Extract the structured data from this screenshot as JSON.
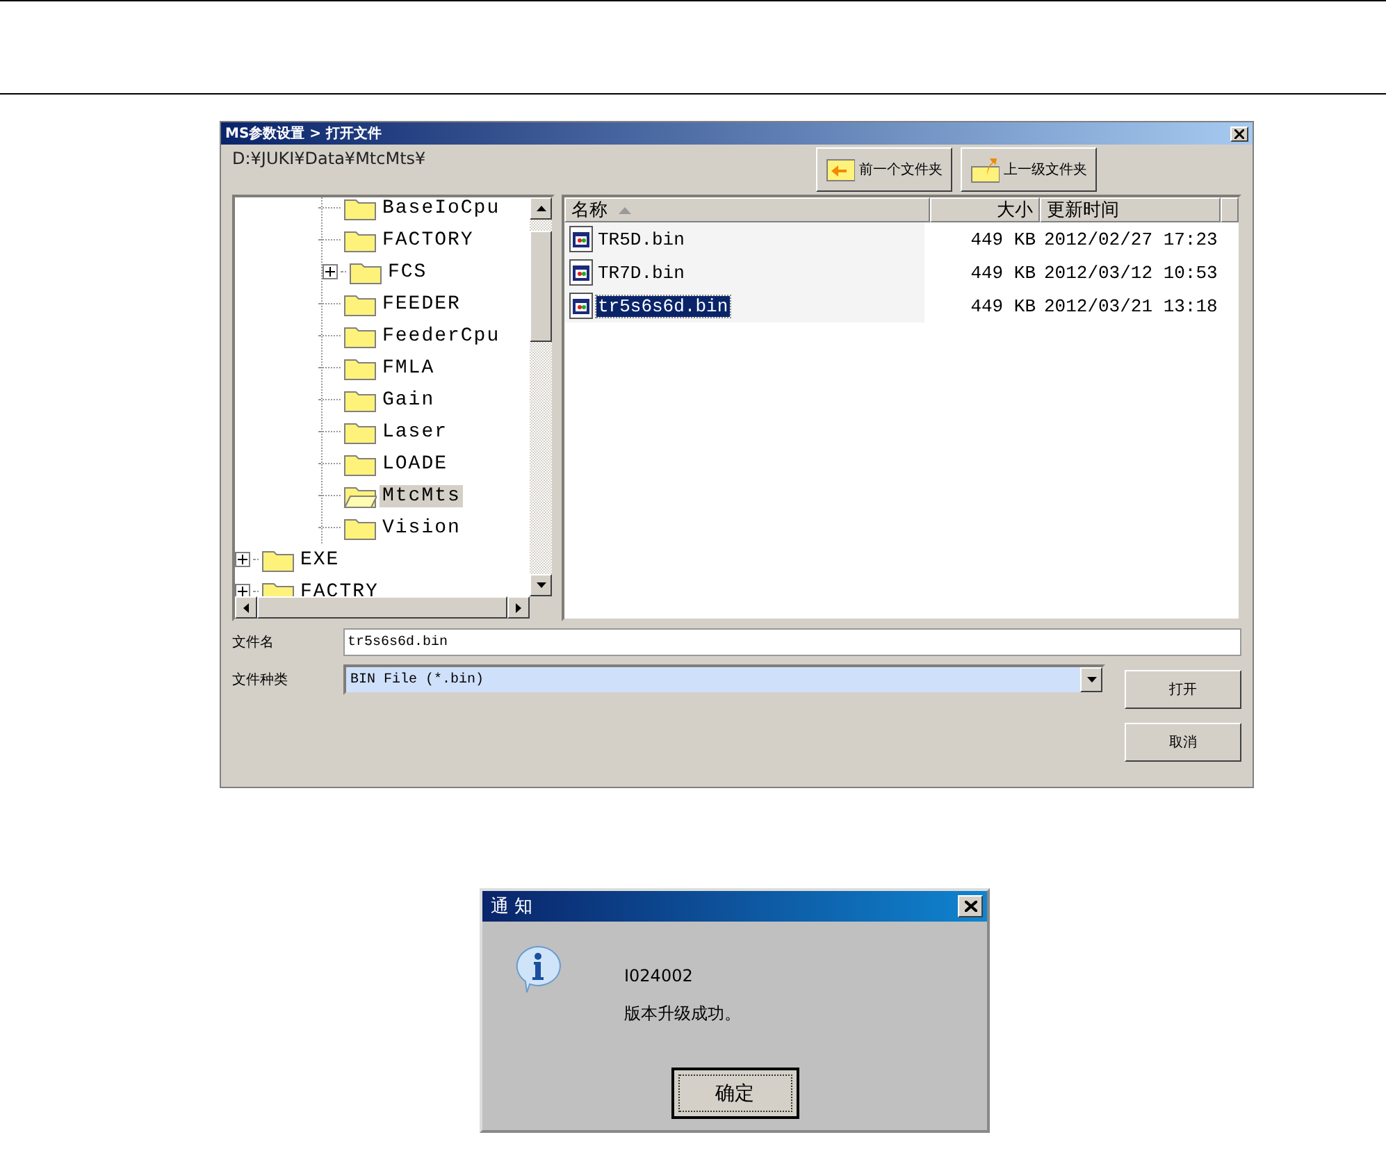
{
  "file_dialog": {
    "title": "MS参数设置 > 打开文件",
    "path": "D:¥JUKI¥Data¥MtcMts¥",
    "toolbar": [
      {
        "label": "前一个文件夹",
        "kind": "back"
      },
      {
        "label": "上一级文件夹",
        "kind": "up"
      }
    ],
    "tree": [
      {
        "children": [
          {
            "label": "BaseIoCpu",
            "expandable": false,
            "selected": false
          },
          {
            "label": "FACTORY",
            "expandable": false,
            "selected": false
          },
          {
            "label": "FCS",
            "expandable": true,
            "selected": false
          },
          {
            "label": "FEEDER",
            "expandable": false,
            "selected": false
          },
          {
            "label": "FeederCpu",
            "expandable": false,
            "selected": false
          },
          {
            "label": "FMLA",
            "expandable": false,
            "selected": false
          },
          {
            "label": "Gain",
            "expandable": false,
            "selected": false
          },
          {
            "label": "Laser",
            "expandable": false,
            "selected": false
          },
          {
            "label": "LOADE",
            "expandable": false,
            "selected": false
          },
          {
            "label": "MtcMts",
            "expandable": false,
            "selected": true
          },
          {
            "label": "Vision",
            "expandable": false,
            "selected": false
          }
        ]
      },
      {
        "label": "EXE",
        "expandable": true,
        "selected": false
      },
      {
        "label": "FACTRY",
        "expandable": true,
        "selected": false
      }
    ],
    "file_list": {
      "columns": [
        {
          "label": "名称",
          "sorted": true
        },
        {
          "label": "大小",
          "sorted": false
        },
        {
          "label": "更新时间",
          "sorted": false
        }
      ],
      "rows": [
        {
          "name": "TR5D.bin",
          "size": "449 KB",
          "modified": "2012/02/27 17:23",
          "selected": false
        },
        {
          "name": "TR7D.bin",
          "size": "449 KB",
          "modified": "2012/03/12 10:53",
          "selected": false
        },
        {
          "name": "tr5s6s6d.bin",
          "size": "449 KB",
          "modified": "2012/03/21 13:18",
          "selected": true
        }
      ]
    },
    "fields": [
      {
        "label": "文件名",
        "value": "tr5s6s6d.bin",
        "kind": "text"
      },
      {
        "label": "文件种类",
        "value": "BIN File (*.bin)",
        "kind": "dropdown"
      }
    ],
    "buttons": [
      "打开",
      "取消"
    ]
  },
  "notice_dialog": {
    "title": "通 知",
    "code": "I024002",
    "message": "版本升级成功。",
    "button": "确定"
  }
}
